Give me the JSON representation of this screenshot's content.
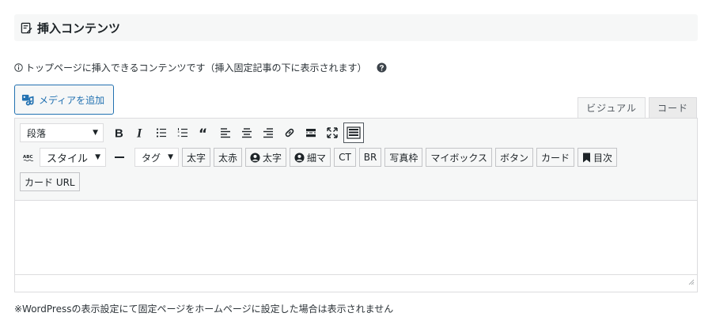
{
  "section": {
    "title": "挿入コンテンツ"
  },
  "info": {
    "text": "トップページに挿入できるコンテンツです（挿入固定記事の下に表示されます）"
  },
  "media_button": {
    "label": "メディアを追加"
  },
  "mode_tabs": [
    {
      "label": "ビジュアル",
      "active": true
    },
    {
      "label": "コード",
      "active": false
    }
  ],
  "toolbar": {
    "format_select": "段落",
    "style_select": "スタイル",
    "tag_select": "タグ",
    "row1_icons": [
      "bold-icon",
      "italic-icon",
      "bulleted-list-icon",
      "numbered-list-icon",
      "blockquote-icon",
      "align-left-icon",
      "align-center-icon",
      "align-right-icon",
      "link-icon",
      "read-more-icon",
      "fullscreen-icon",
      "toolbar-toggle-icon"
    ],
    "row2_buttons": [
      "太字",
      "太赤",
      "太字",
      "細マ",
      "CT",
      "BR",
      "写真枠",
      "マイボックス",
      "ボタン",
      "カード",
      "目次"
    ],
    "row3_buttons": [
      "カード URL"
    ]
  },
  "footnote": {
    "text": "※WordPressの表示設定にて固定ページをホームページに設定した場合は表示されません"
  },
  "colors": {
    "accent": "#2271b1",
    "toolbar_bg": "#f6f7f7",
    "border": "#dcdcde"
  }
}
